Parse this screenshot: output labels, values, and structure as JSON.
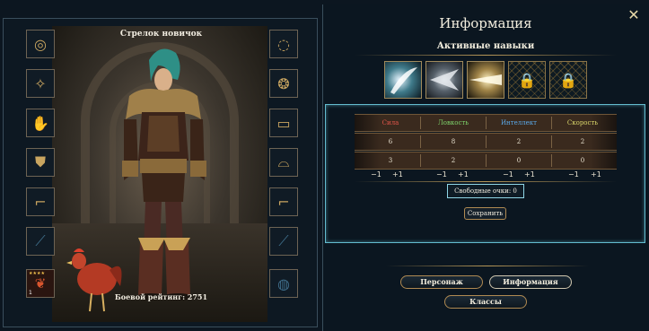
{
  "character": {
    "title": "Стрелок новичок",
    "rating": "Боевой рейтинг: 2751"
  },
  "equipment_left": [
    {
      "name": "ring-icon",
      "glyph": "◎"
    },
    {
      "name": "amulet-icon",
      "glyph": "✧"
    },
    {
      "name": "gloves-slot-icon",
      "glyph": "✋"
    },
    {
      "name": "shoulder-armor-icon",
      "glyph": "⛊"
    },
    {
      "name": "boots-icon",
      "glyph": "⌐"
    },
    {
      "name": "weapon-slot-icon",
      "glyph": "⟋"
    }
  ],
  "equipment_right": [
    {
      "name": "bracelet-icon",
      "glyph": "◌"
    },
    {
      "name": "earrings-icon",
      "glyph": "❂"
    },
    {
      "name": "bracer-icon",
      "glyph": "▭"
    },
    {
      "name": "belt-icon",
      "glyph": "⌓"
    },
    {
      "name": "greaves-icon",
      "glyph": "⌐"
    },
    {
      "name": "sword-slot-icon",
      "glyph": "⟋"
    },
    {
      "name": "mount-slot-icon",
      "glyph": "◍"
    }
  ],
  "pet": {
    "level": "1",
    "stars": "★★★★"
  },
  "info": {
    "title": "Информация",
    "close": "✕",
    "skills_title": "Активные навыки"
  },
  "stats": {
    "headers": [
      {
        "label": "Сила",
        "color": "#e2554a"
      },
      {
        "label": "Ловкость",
        "color": "#7ed36b"
      },
      {
        "label": "Интеллект",
        "color": "#5aa7e6"
      },
      {
        "label": "Скорость",
        "color": "#d9d56a"
      }
    ],
    "base": [
      "6",
      "8",
      "2",
      "2"
    ],
    "added": [
      "3",
      "2",
      "0",
      "0"
    ],
    "minus": "−1",
    "plus": "+1",
    "free_points": "Свободные очки: 0",
    "save": "Сохранить"
  },
  "nav": {
    "character": "Персонаж",
    "information": "Информация",
    "classes": "Классы"
  },
  "colors": {
    "accent_gold": "#b08a52",
    "highlight_cyan": "#63bccf"
  }
}
